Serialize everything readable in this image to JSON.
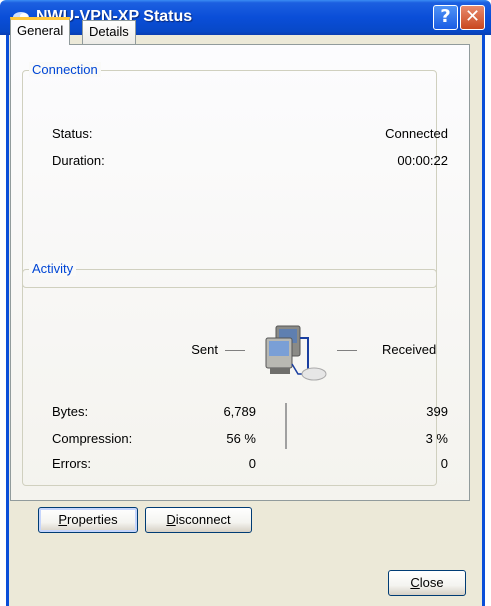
{
  "window": {
    "title": "NWU-VPN-XP Status",
    "help_label": "?",
    "close_label": "✕"
  },
  "tabs": [
    {
      "label": "General",
      "active": true
    },
    {
      "label": "Details",
      "active": false
    }
  ],
  "connection": {
    "legend": "Connection",
    "status_label": "Status:",
    "status_value": "Connected",
    "duration_label": "Duration:",
    "duration_value": "00:00:22"
  },
  "activity": {
    "legend": "Activity",
    "sent_label": "Sent",
    "received_label": "Received",
    "rows": [
      {
        "label": "Bytes:",
        "sent": "6,789",
        "received": "399"
      },
      {
        "label": "Compression:",
        "sent": "56 %",
        "received": "3 %"
      },
      {
        "label": "Errors:",
        "sent": "0",
        "received": "0"
      }
    ],
    "icon": "network-computers-icon"
  },
  "buttons": {
    "properties_first": "P",
    "properties_rest": "roperties",
    "disconnect_first": "D",
    "disconnect_rest": "isconnect",
    "close_first": "C",
    "close_rest": "lose"
  },
  "colors": {
    "titlebar": "#0a4ed8",
    "legend_text": "#0046d5",
    "dialog_bg": "#ece9d8",
    "close_button": "#c9471f"
  }
}
